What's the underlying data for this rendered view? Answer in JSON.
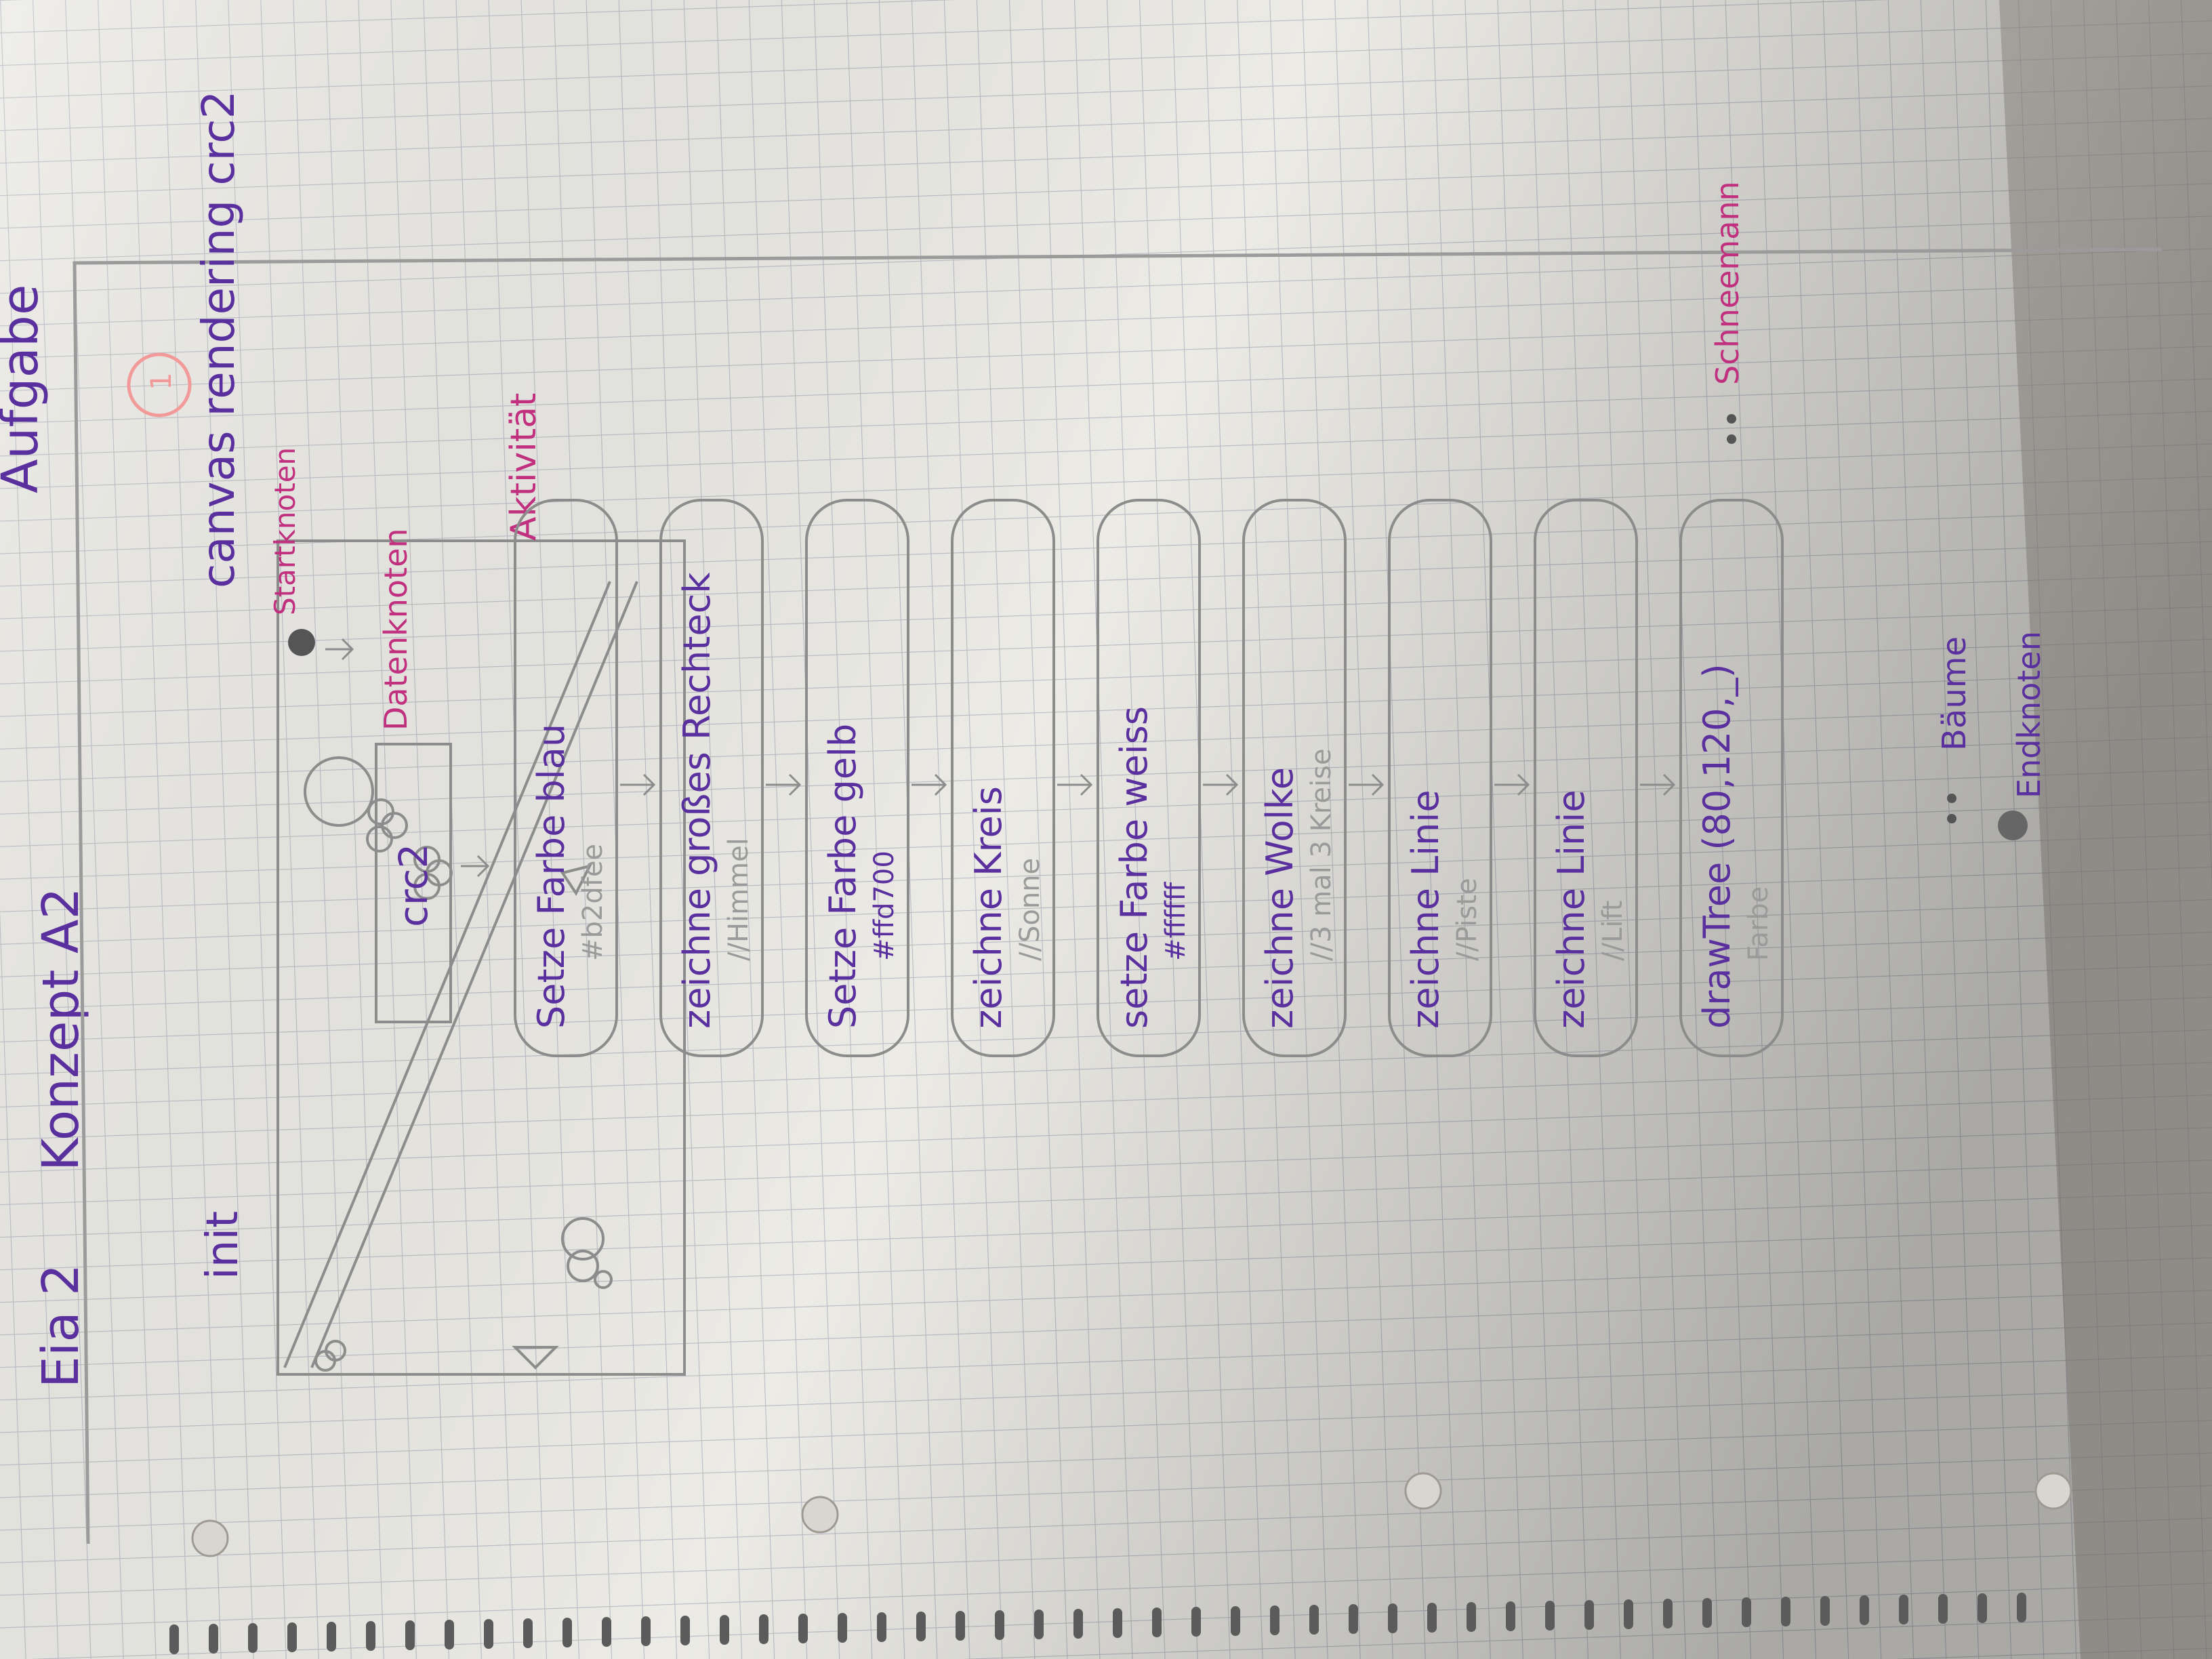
{
  "header": {
    "course": "Eia 2",
    "title": "Konzept A2",
    "title_cut": "Aufgabe",
    "page_number": "1"
  },
  "colors": {
    "paper": "#ecebe6",
    "grid": "#b9bcc4",
    "pencil": "#8c8c8c",
    "purple": "#5a2f9e",
    "magenta": "#c0307f",
    "red_circle": "#f29a9a"
  },
  "diagram": {
    "frame_label": "init",
    "activity_title": "canvas rendering crc2",
    "start_label": "Startknoten",
    "data_node_label": "Datenknoten",
    "data_node_text": "crc2",
    "activity_label": "Aktivität",
    "nodes": [
      {
        "main": "Setze Farbe blau",
        "note": "#b2dfee"
      },
      {
        "main": "zeichne großes Rechteck",
        "note": "//Himmel"
      },
      {
        "main": "Setze Farbe gelb",
        "note": "#ffd700"
      },
      {
        "main": "zeichne Kreis",
        "note": "//Sonne"
      },
      {
        "main": "setze Farbe weiss",
        "note": "#ffffff"
      },
      {
        "main": "zeichne Wolke",
        "note": "//3 mal 3 Kreise"
      },
      {
        "main": "zeichne Linie",
        "note": "//Piste"
      },
      {
        "main": "zeichne Linie",
        "note": "//Lift"
      },
      {
        "main": "drawTree (80,120,_)",
        "note": "Farbe"
      }
    ],
    "snowman_label": "Schneemann",
    "trees_label": "Bäume",
    "end_label": "Endknoten"
  }
}
